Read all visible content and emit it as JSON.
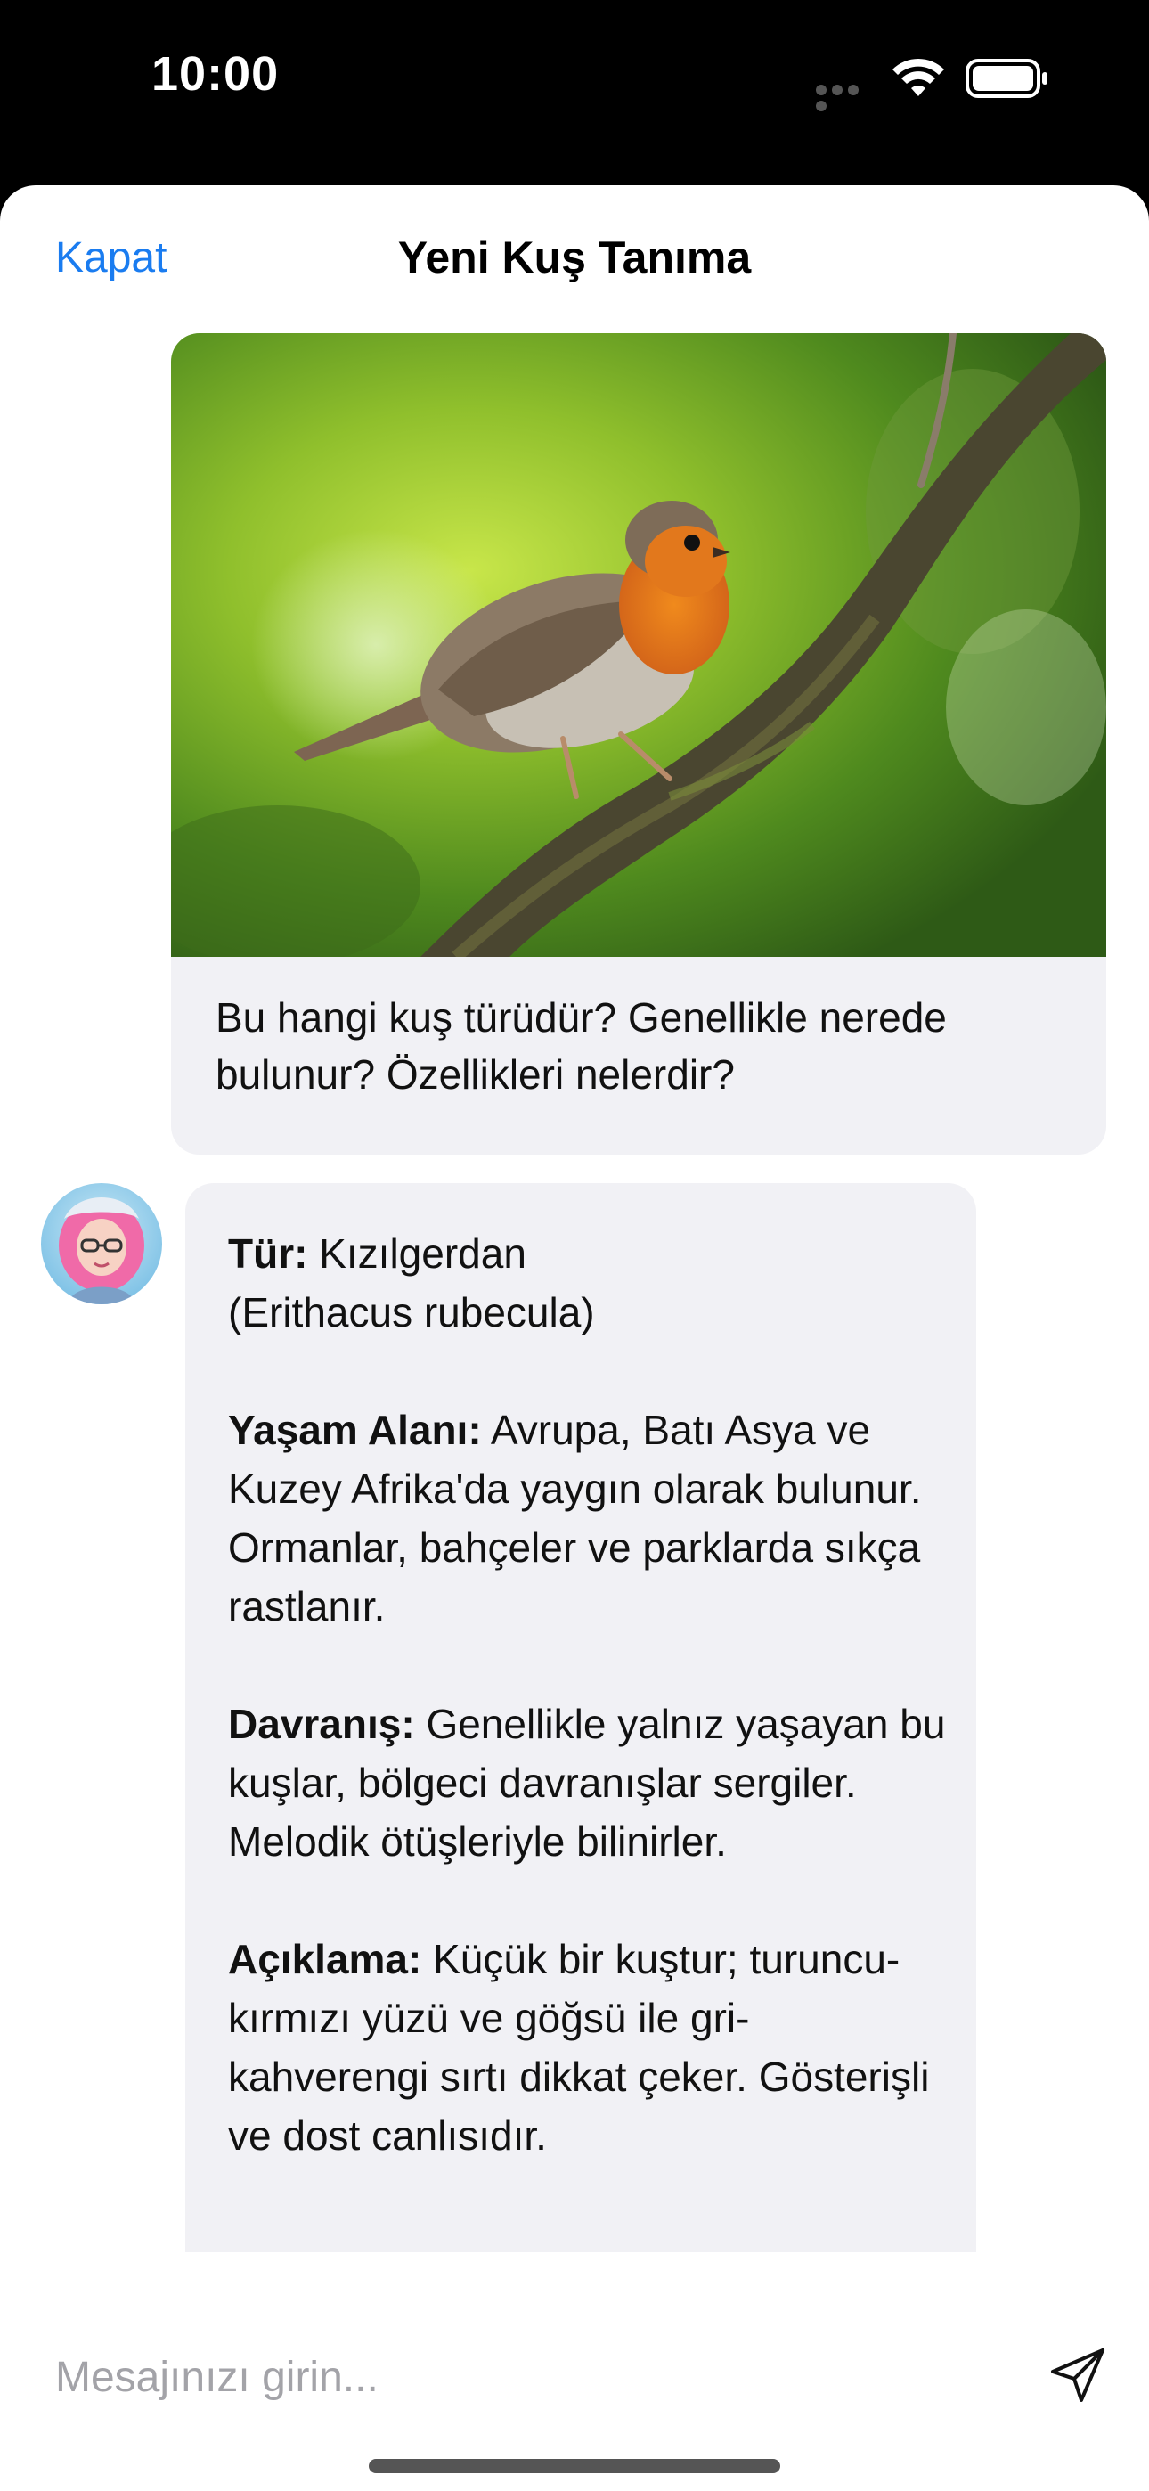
{
  "status_bar": {
    "time": "10:00",
    "icons": [
      "cellular-signal-icon",
      "wifi-icon",
      "battery-icon"
    ]
  },
  "header": {
    "close_label": "Kapat",
    "title": "Yeni Kuş Tanıma"
  },
  "user_message": {
    "image": "robin-on-branch-photo",
    "text": "Bu hangi kuş türüdür? Genellikle nerede bulunur? Özellikleri nelerdir?"
  },
  "assistant_message": {
    "avatar": "cartoon-girl-avatar",
    "species_label": "Tür:",
    "species_value": "Kızılgerdan",
    "species_latin": "(Erithacus rubecula)",
    "habitat_label": "Yaşam Alanı:",
    "habitat_value": "Avrupa, Batı Asya ve Kuzey Afrika'da yaygın olarak bulunur. Ormanlar, bahçeler ve parklarda sıkça rastlanır.",
    "behavior_label": "Davranış:",
    "behavior_value": "Genellikle yalnız yaşayan bu kuşlar, bölgeci davranışlar sergiler. Melodik ötüşleriyle bilinirler.",
    "description_label": "Açıklama:",
    "description_value": "Küçük bir kuştur; turuncu-kırmızı yüzü ve göğsü ile gri-kahverengi sırtı dikkat çeker. Gösterişli ve dost canlısıdır."
  },
  "composer": {
    "placeholder": "Mesajınızı girin...",
    "value": "",
    "send_icon": "paper-plane-icon"
  },
  "colors": {
    "accent": "#1a7cf0",
    "bubble": "#f1f1f5",
    "placeholder": "#a3a3a8"
  }
}
